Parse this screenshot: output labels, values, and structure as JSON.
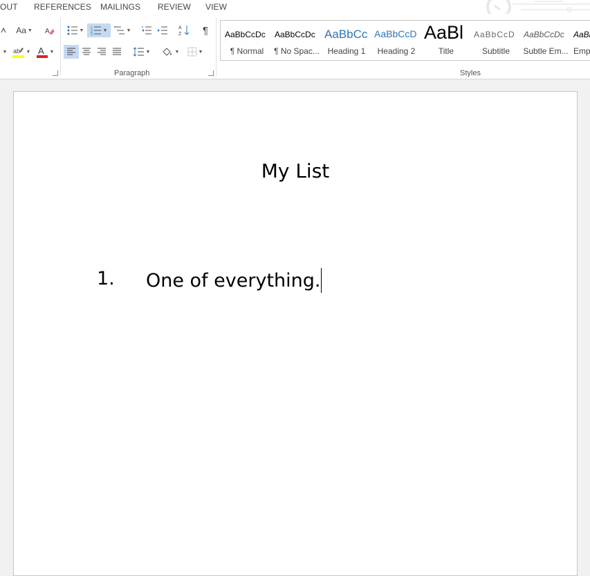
{
  "tabs": [
    "OUT",
    "REFERENCES",
    "MAILINGS",
    "REVIEW",
    "VIEW"
  ],
  "ribbon": {
    "font_group": {
      "case_label": "Aa",
      "font_color": "#e0201b",
      "highlight_color": "#ffff00"
    },
    "paragraph_label": "Paragraph",
    "styles_label": "Styles",
    "pilcrow": "¶",
    "sort_label": "A↓Z"
  },
  "styles": [
    {
      "preview": "AaBbCcDc",
      "name": "¶ Normal"
    },
    {
      "preview": "AaBbCcDc",
      "name": "¶ No Spac..."
    },
    {
      "preview": "AaBbCc",
      "name": "Heading 1"
    },
    {
      "preview": "AaBbCcD",
      "name": "Heading 2"
    },
    {
      "preview": "AaBl",
      "name": "Title"
    },
    {
      "preview": "AaBbCcD",
      "name": "Subtitle"
    },
    {
      "preview": "AaBbCcDc",
      "name": "Subtle Em..."
    },
    {
      "preview": "AaBbCcD",
      "name": "Emp"
    }
  ],
  "document": {
    "title": "My List",
    "list": [
      {
        "number": "1.",
        "text": "One of everything."
      }
    ]
  },
  "colors": {
    "accent_blue": "#2e74b5",
    "selected_bg": "#c5d9f1"
  }
}
